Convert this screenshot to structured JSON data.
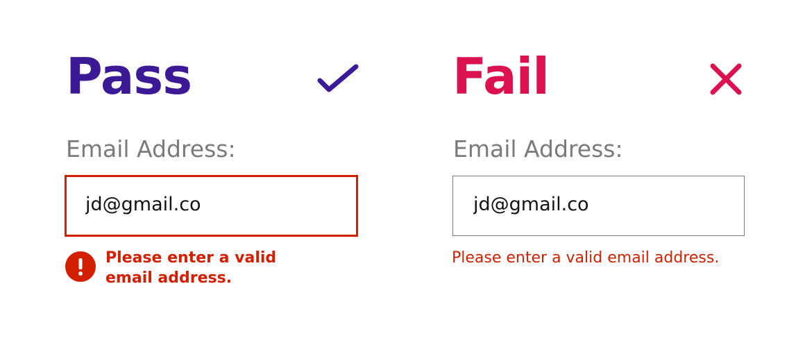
{
  "pass": {
    "title": "Pass",
    "title_color": "#3d1a95",
    "status_icon": "checkmark-icon",
    "field_label": "Email Address:",
    "input_value": "jd@gmail.co",
    "error_icon": "exclamation-circle-icon",
    "error_message_line1": "Please enter a valid",
    "error_message_line2": "email address."
  },
  "fail": {
    "title": "Fail",
    "title_color": "#dc1250",
    "status_icon": "close-x-icon",
    "field_label": "Email Address:",
    "input_value": "jd@gmail.co",
    "error_message": "Please enter a valid email address."
  },
  "colors": {
    "error": "#d11f00",
    "label_gray": "#7a7a7a",
    "input_border": "#7a7a7a"
  }
}
